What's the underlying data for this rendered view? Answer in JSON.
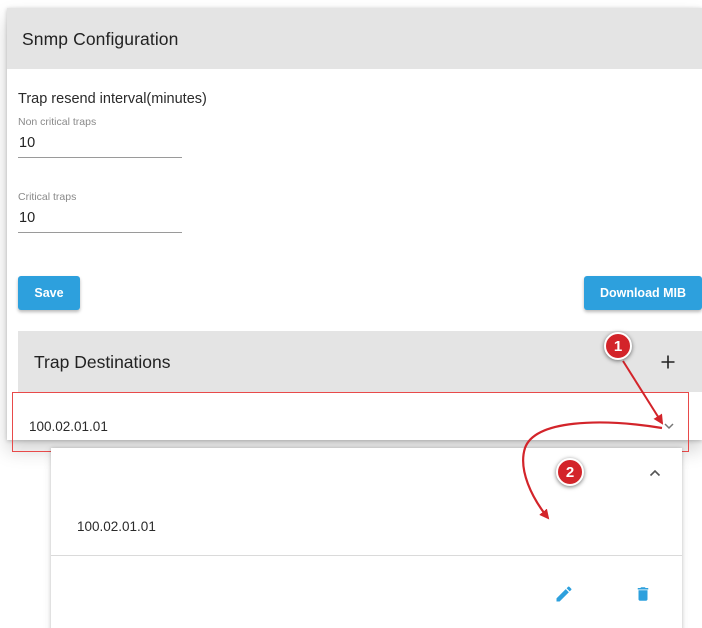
{
  "snmp": {
    "title": "Snmp Configuration",
    "trap_resend_label": "Trap resend interval(minutes)",
    "non_critical": {
      "label": "Non critical traps",
      "value": "10"
    },
    "critical": {
      "label": "Critical traps",
      "value": "10"
    },
    "save_label": "Save",
    "download_label": "Download MIB"
  },
  "trap_destinations": {
    "title": "Trap Destinations",
    "add_icon": "plus-icon",
    "collapsed_row": {
      "address": "100.02.01.01",
      "icon": "chevron-down-icon"
    },
    "expanded_row": {
      "address": "100.02.01.01",
      "collapse_icon": "chevron-up-icon",
      "edit_icon": "pencil-icon",
      "delete_icon": "trash-icon"
    }
  },
  "annotations": {
    "callout_1": "1",
    "callout_2": "2"
  },
  "colors": {
    "accent": "#2da0dd",
    "header_bg": "#e4e4e4",
    "callout_red": "#d3242a",
    "selection_border": "#e84a4a"
  }
}
